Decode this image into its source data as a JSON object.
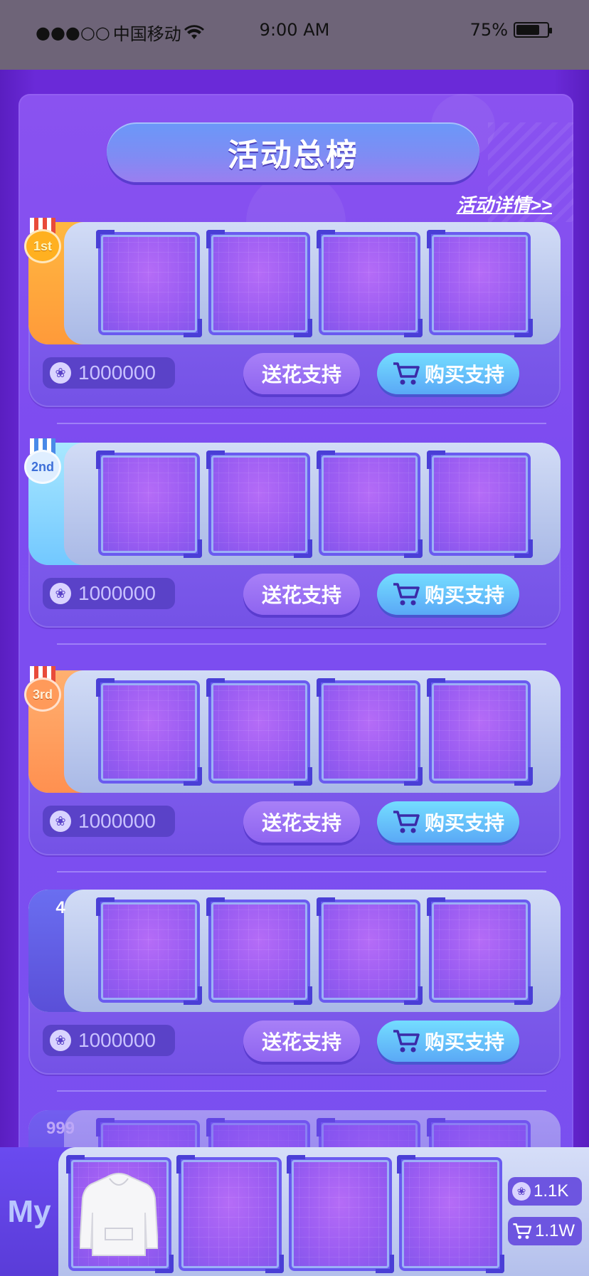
{
  "status_bar": {
    "signal": "●●●○○",
    "carrier": "中国移动",
    "time": "9:00 AM",
    "battery": "75%",
    "battery_level": 0.75
  },
  "header": {
    "title": "活动总榜",
    "details_link": "活动详情>>"
  },
  "rankings": [
    {
      "rank_label": "1st",
      "flowers": "1000000",
      "flower_btn": "送花支持",
      "buy_btn": "购买支持"
    },
    {
      "rank_label": "2nd",
      "flowers": "1000000",
      "flower_btn": "送花支持",
      "buy_btn": "购买支持"
    },
    {
      "rank_label": "3rd",
      "flowers": "1000000",
      "flower_btn": "送花支持",
      "buy_btn": "购买支持"
    },
    {
      "rank_label": "4",
      "flowers": "1000000",
      "flower_btn": "送花支持",
      "buy_btn": "购买支持"
    },
    {
      "rank_label": "999"
    }
  ],
  "my_entry": {
    "label": "My",
    "flowers": "1.1K",
    "purchases": "1.1W"
  },
  "icons": {
    "flower": "flower-icon",
    "cart": "cart-icon",
    "wifi": "wifi-icon",
    "battery": "battery-icon",
    "hoodie": "hoodie-icon"
  },
  "colors": {
    "primary_purple": "#7a50f0",
    "button_blue": "#5aa8f6",
    "gold": "#ffb020",
    "silver": "#72c8ff",
    "bronze": "#ff9a5a"
  }
}
